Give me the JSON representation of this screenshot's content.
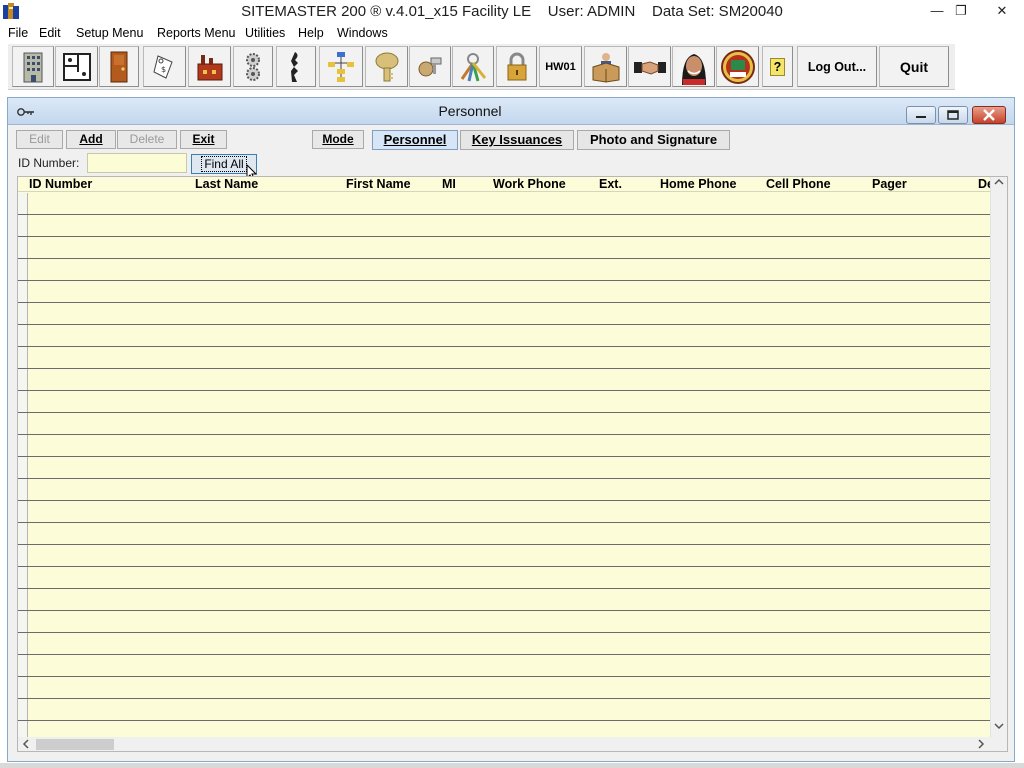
{
  "window": {
    "title": "SITEMASTER 200 ® v.4.01_x15 Facility LE    User: ADMIN    Data Set: SM20040",
    "min_glyph": "—",
    "restore_glyph": "❐",
    "close_glyph": "✕"
  },
  "menu": {
    "items": [
      "File",
      "Edit",
      "Setup Menu",
      "Reports Menu",
      "Utilities",
      "Help",
      "Windows"
    ]
  },
  "toolbar": {
    "icons": [
      "building-icon",
      "floor-plan-icon",
      "door-icon",
      "tag-icon",
      "factory-icon",
      "gears-icon",
      "key-blank-icon",
      "hierarchy-icon",
      "gold-key-icon",
      "key-core-icon",
      "key-ring-icon",
      "padlock-icon"
    ],
    "hw_label": "HW01",
    "logout_label": "Log Out...",
    "quit_label": "Quit",
    "help_glyph": "?"
  },
  "child_window": {
    "title": "Personnel"
  },
  "actions": {
    "edit": "Edit",
    "add": "Add",
    "delete": "Delete",
    "exit": "Exit",
    "mode": "Mode"
  },
  "tabs": {
    "personnel": "Personnel",
    "key_issuances": "Key Issuances",
    "photo_signature": "Photo and Signature"
  },
  "search": {
    "label": "ID Number:",
    "value": "",
    "find_all": "Find All"
  },
  "grid": {
    "columns": [
      "ID Number",
      "Last Name",
      "First Name",
      "MI",
      "Work Phone",
      "Ext.",
      "Home Phone",
      "Cell Phone",
      "Pager",
      "De"
    ],
    "row_count": 25
  },
  "colors": {
    "grid_bg": "#fcfcd8",
    "input_bg": "#fcfcd6",
    "title_gradient_top": "#dce9f7",
    "close_red": "#c6412a"
  }
}
